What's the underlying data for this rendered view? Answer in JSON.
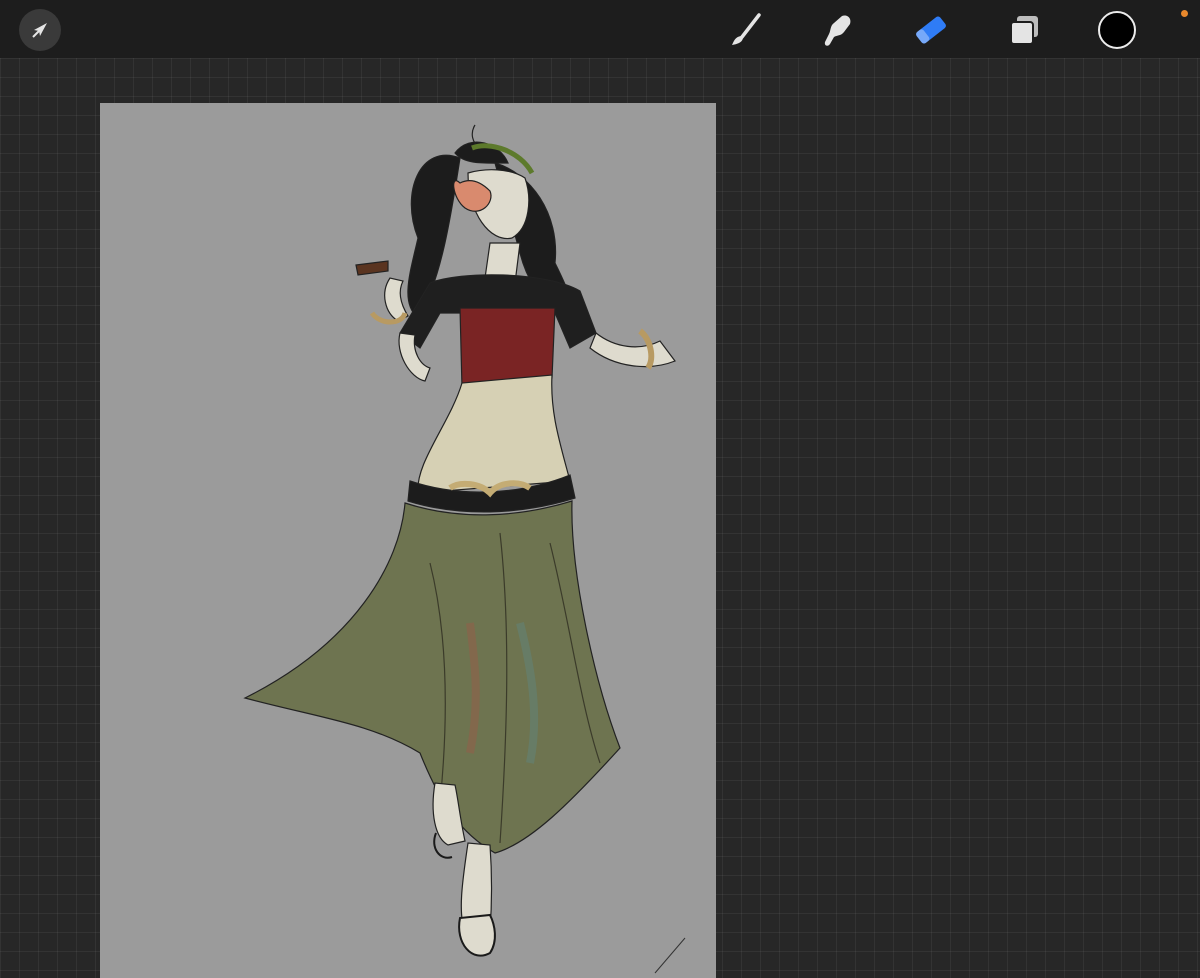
{
  "app": {
    "accent_color": "#2f7cf6",
    "status_dot_color": "#e8882c"
  },
  "toolbar": {
    "actions_icon": "arrow-cursor-icon",
    "tools": [
      {
        "name": "brush",
        "icon": "brush-icon",
        "active": false
      },
      {
        "name": "smudge",
        "icon": "smudge-icon",
        "active": false
      },
      {
        "name": "eraser",
        "icon": "eraser-icon",
        "active": true
      },
      {
        "name": "layers",
        "icon": "layers-icon",
        "active": false
      }
    ],
    "current_color": "#000000"
  },
  "canvas": {
    "background_color": "#9b9b9b",
    "artwork": "sketch-figure"
  }
}
